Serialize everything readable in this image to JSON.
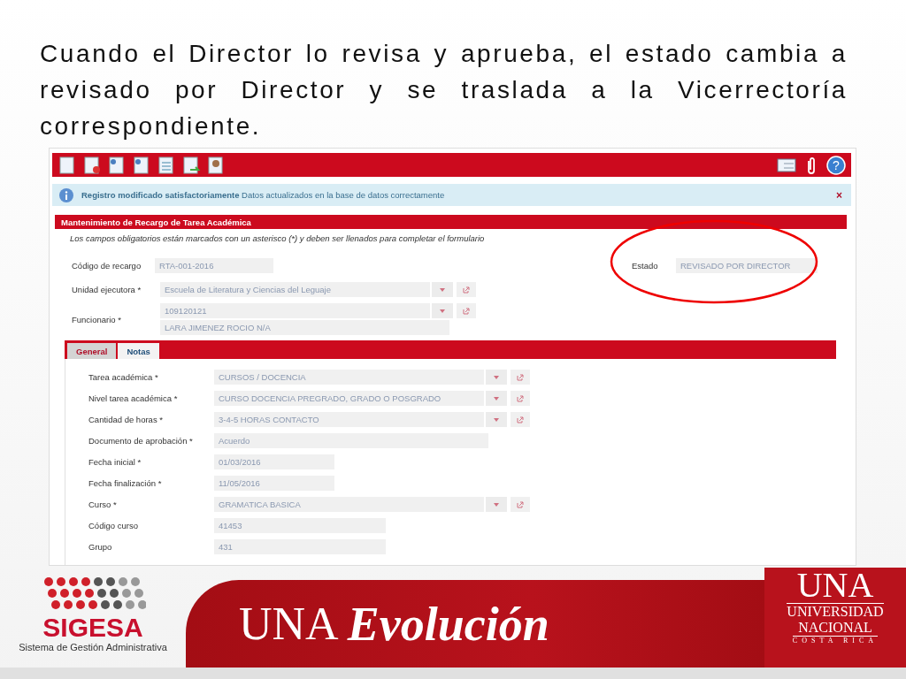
{
  "slide": {
    "heading": "Cuando el Director lo revisa y aprueba, el estado cambia a revisado por Director y se traslada a la Vicerrectoría correspondiente."
  },
  "toolbar": {
    "help": "?"
  },
  "alert": {
    "title": "Registro modificado satisfactoriamente",
    "message": "Datos actualizados en la base de datos correctamente",
    "close": "×"
  },
  "form": {
    "title": "Mantenimiento de Recargo de Tarea Académica",
    "note": "Los campos obligatorios están marcados con un asterisco (*) y deben ser llenados para completar el formulario",
    "code": {
      "label": "Código de recargo",
      "value": "RTA-001-2016"
    },
    "status": {
      "label": "Estado",
      "value": "REVISADO POR DIRECTOR"
    },
    "unit": {
      "label": "Unidad ejecutora *",
      "value": "Escuela de Literatura y Ciencias del Leguaje"
    },
    "employee": {
      "label": "Funcionario *",
      "value": "109120121",
      "name": "LARA  JIMENEZ ROCIO N/A"
    }
  },
  "tabs": [
    {
      "label": "General",
      "selected": true
    },
    {
      "label": "Notas",
      "selected": false
    }
  ],
  "fields": [
    {
      "label": "Tarea académica *",
      "value": "CURSOS / DOCENCIA",
      "kind": "select"
    },
    {
      "label": "Nivel tarea académica *",
      "value": "CURSO DOCENCIA PREGRADO, GRADO O POSGRADO",
      "kind": "select"
    },
    {
      "label": "Cantidad de horas *",
      "value": "3-4-5 HORAS CONTACTO",
      "kind": "select"
    },
    {
      "label": "Documento de aprobación *",
      "value": "Acuerdo",
      "kind": "wide"
    },
    {
      "label": "Fecha inicial *",
      "value": "01/03/2016",
      "kind": "short"
    },
    {
      "label": "Fecha finalización *",
      "value": "11/05/2016",
      "kind": "short"
    },
    {
      "label": "Curso *",
      "value": "GRAMATICA BASICA",
      "kind": "select"
    },
    {
      "label": "Código curso",
      "value": "41453",
      "kind": "medium"
    },
    {
      "label": "Grupo",
      "value": "431",
      "kind": "medium"
    }
  ],
  "footer": {
    "brand": "SIGESA",
    "tagline": "Sistema de Gestión Administrativa",
    "banner_left": "UNA",
    "banner_right": "Evolución",
    "logo": "UNA",
    "logo_line_1": "UNIVERSIDAD",
    "logo_line_2": "NACIONAL",
    "logo_line_3": "COSTA RICA"
  }
}
